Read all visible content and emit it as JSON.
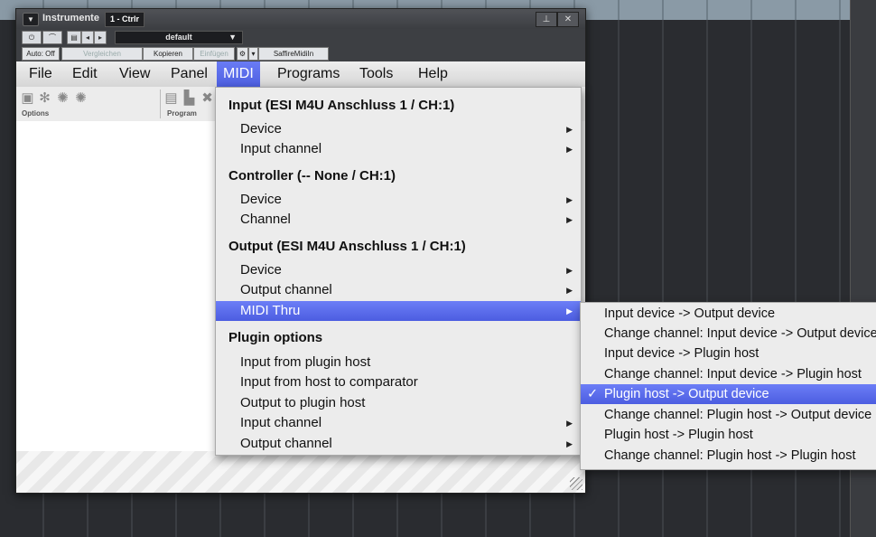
{
  "window": {
    "title": "Instrumente",
    "slot": "1 - Ctrlr",
    "preset": "default",
    "auto_label": "Auto: Off",
    "compare_label": "Vergleichen",
    "copy_label": "Kopieren",
    "paste_label": "Einfügen",
    "device_label": "SaffireMidiIn",
    "pin_glyph": "⊥",
    "close_glyph": "✕"
  },
  "menubar": [
    "File",
    "Edit",
    "View",
    "Panel",
    "MIDI",
    "Programs",
    "Tools",
    "Help"
  ],
  "toolbar": {
    "options_label": "Options",
    "program_label": "Program"
  },
  "midi_menu": {
    "input_header": "Input (ESI M4U Anschluss 1 / CH:1)",
    "input_device": "Device",
    "input_channel": "Input channel",
    "controller_header": "Controller (-- None / CH:1)",
    "controller_device": "Device",
    "controller_channel": "Channel",
    "output_header": "Output  (ESI M4U Anschluss 1 / CH:1)",
    "output_device": "Device",
    "output_channel": "Output channel",
    "midi_thru": "MIDI Thru",
    "plugin_header": "Plugin options",
    "input_from_host": "Input from plugin host",
    "input_host_comparator": "Input from host to comparator",
    "output_to_host": "Output to plugin host"
  },
  "thru_submenu": [
    "Input device -> Output device",
    "Change channel: Input device -> Output device",
    "Input device -> Plugin host",
    "Change channel: Input device -> Plugin host",
    "Plugin host -> Output device",
    "Change channel: Plugin host -> Output device",
    "Plugin host -> Plugin host",
    "Change channel: Plugin host -> Plugin host"
  ],
  "checkmark": "✓",
  "colors": {
    "highlight": "#5566ea",
    "menu_bg": "#ececec"
  }
}
